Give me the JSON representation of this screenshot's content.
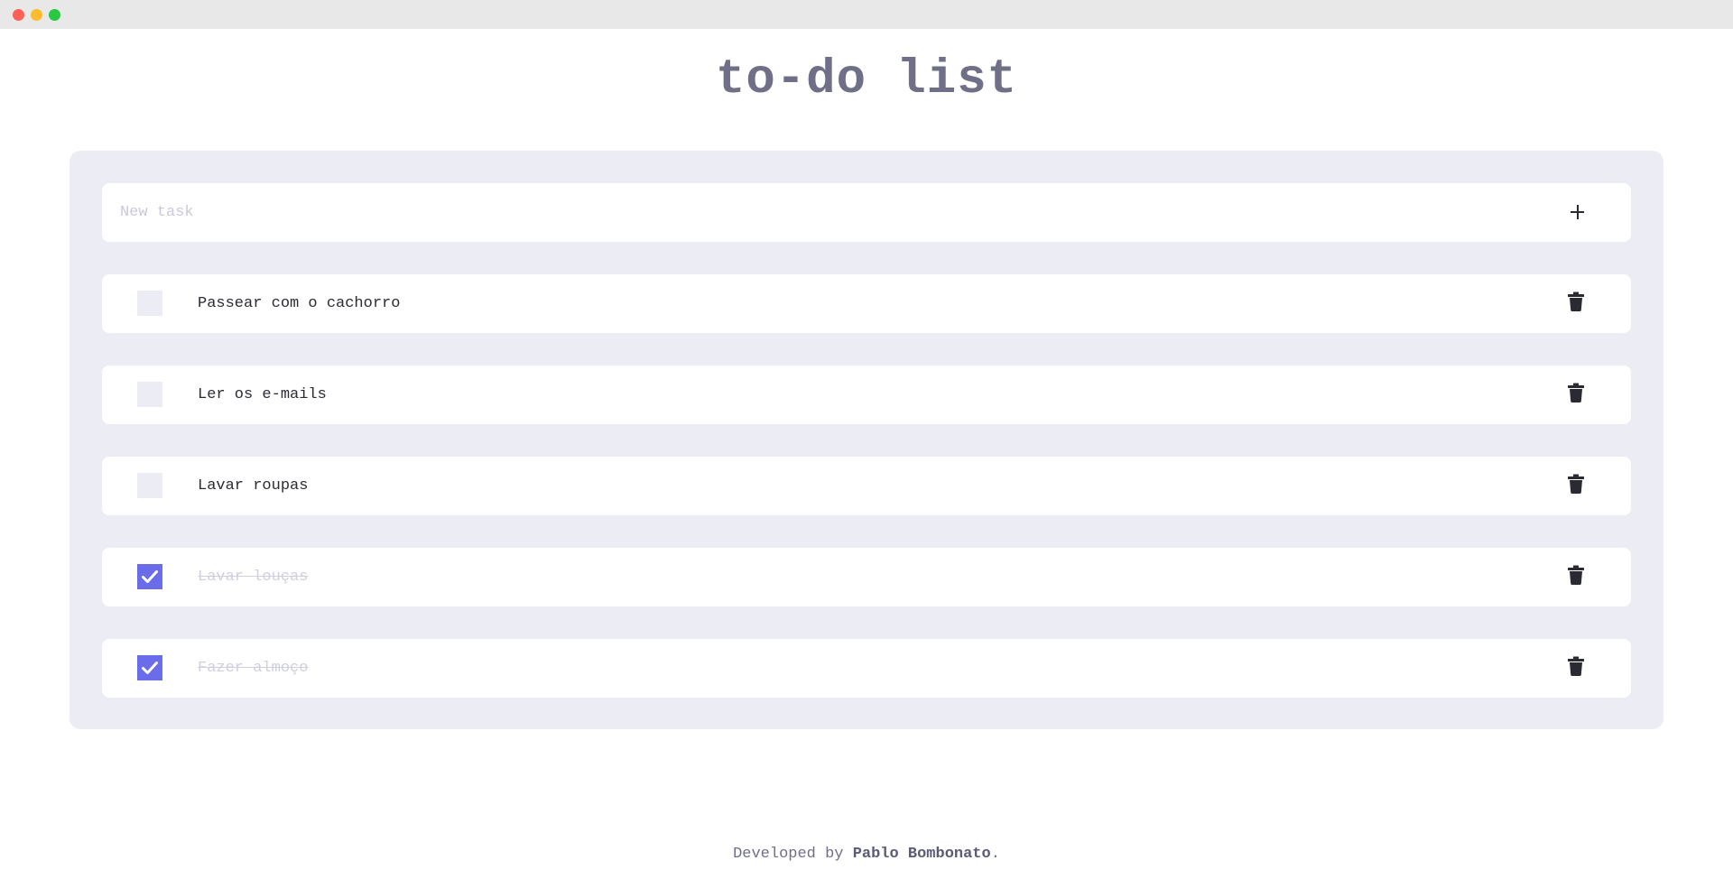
{
  "app": {
    "title": "to-do list"
  },
  "new_task": {
    "placeholder": "New task",
    "value": "",
    "add_icon": "plus-icon"
  },
  "tasks": [
    {
      "label": "Passear com o cachorro",
      "done": false
    },
    {
      "label": "Ler os e-mails",
      "done": false
    },
    {
      "label": "Lavar roupas",
      "done": false
    },
    {
      "label": "Lavar louças",
      "done": true
    },
    {
      "label": "Fazer almoço",
      "done": true
    }
  ],
  "task_icons": {
    "delete": "trash-icon",
    "checked": "check-icon"
  },
  "footer": {
    "prefix": "Developed by ",
    "author": "Pablo Bombonato",
    "suffix": "."
  },
  "colors": {
    "accent": "#6a6cea",
    "panel_bg": "#ececf5",
    "title": "#6f6f87",
    "done_text": "#cfcfe0"
  }
}
